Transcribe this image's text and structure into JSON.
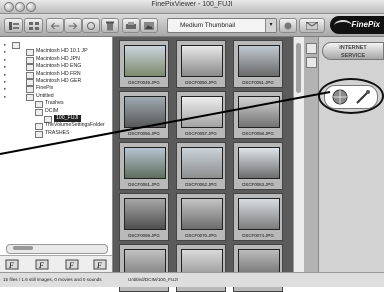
{
  "window": {
    "title": "FinePixViewer - 100_FUJI"
  },
  "toolbar": {
    "view_select": "Medium Thumbnail",
    "logo_text": "FinePix"
  },
  "tree": {
    "items": [
      {
        "label": "",
        "level": 0
      },
      {
        "label": "Macintosh HD 10.1 JP",
        "level": 1
      },
      {
        "label": "Macintosh HD JPN",
        "level": 1
      },
      {
        "label": "Macintosh HD ENG",
        "level": 1
      },
      {
        "label": "Macintosh HD FRN",
        "level": 1
      },
      {
        "label": "Macintosh HD GER",
        "level": 1
      },
      {
        "label": "FinePix",
        "level": 1
      },
      {
        "label": "Untitled",
        "level": 1
      },
      {
        "label": "Trashes",
        "level": 2
      },
      {
        "label": "DCIM",
        "level": 2
      },
      {
        "label": "100_FUJI",
        "level": 3,
        "selected": true
      },
      {
        "label": "TheVolumeSettingsFolder",
        "level": 2
      },
      {
        "label": "TRASHES",
        "level": 2
      }
    ]
  },
  "thumbnails": [
    {
      "caption": "DSCF0049.JPG"
    },
    {
      "caption": "DSCF0050.JPG"
    },
    {
      "caption": "DSCF0051.JPG"
    },
    {
      "caption": "DSCF0056.JPG"
    },
    {
      "caption": "DSCF0057.JPG"
    },
    {
      "caption": "DSCF0058.JPG"
    },
    {
      "caption": "DSCF0061.JPG"
    },
    {
      "caption": "DSCF0062.JPG"
    },
    {
      "caption": "DSCF0063.JPG"
    },
    {
      "caption": "DSCF0069.JPG"
    },
    {
      "caption": "DSCF0070.JPG"
    },
    {
      "caption": "DSCF0074.JPG"
    },
    {
      "caption": ""
    },
    {
      "caption": ""
    },
    {
      "caption": ""
    }
  ],
  "right_panel": {
    "service_label_1": "INTERNET",
    "service_label_2": "SERVICE"
  },
  "status": {
    "left": "15 files / 1.6 still images, 0 movies and 0 sounds",
    "path": "Untitled/DCIM/100_FUJI"
  },
  "colors": {
    "thumbnail_bg": "#5b5b5b",
    "selection": "#222222",
    "window_chrome": "#c9c9c9"
  }
}
